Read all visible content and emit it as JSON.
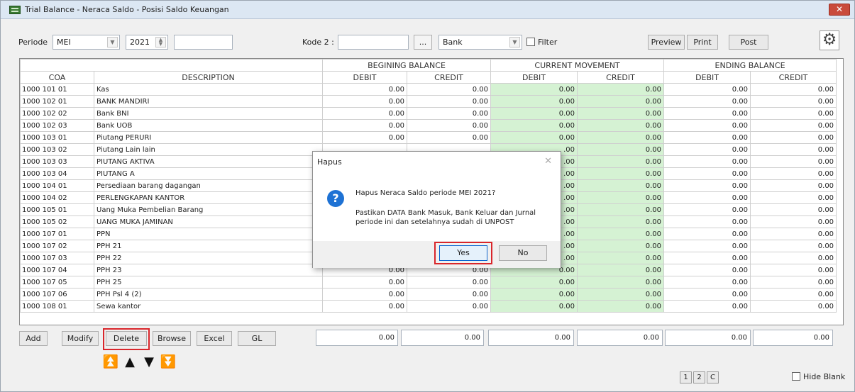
{
  "window": {
    "title": "Trial Balance - Neraca Saldo - Posisi Saldo Keuangan",
    "close_label": "✕"
  },
  "toolbar": {
    "periode_label": "Periode",
    "month": "MEI",
    "year": "2021",
    "extra_value": "",
    "kode2_label": "Kode 2 :",
    "kode2_value": "",
    "browse_label": "...",
    "bank_value": "Bank",
    "filter_label": "Filter",
    "preview_label": "Preview",
    "print_label": "Print",
    "post_label": "Post",
    "gear_icon": "gear-icon"
  },
  "grid": {
    "groups": [
      "BEGINING BALANCE",
      "CURRENT MOVEMENT",
      "ENDING BALANCE"
    ],
    "columns": [
      "COA",
      "DESCRIPTION",
      "DEBIT",
      "CREDIT",
      "DEBIT",
      "CREDIT",
      "DEBIT",
      "CREDIT"
    ],
    "rows": [
      {
        "coa": "1000 101 01",
        "desc": "Kas",
        "v": [
          "0.00",
          "0.00",
          "0.00",
          "0.00",
          "0.00",
          "0.00"
        ]
      },
      {
        "coa": "1000 102 01",
        "desc": "BANK MANDIRI",
        "v": [
          "0.00",
          "0.00",
          "0.00",
          "0.00",
          "0.00",
          "0.00"
        ]
      },
      {
        "coa": "1000 102 02",
        "desc": "Bank BNI",
        "v": [
          "0.00",
          "0.00",
          "0.00",
          "0.00",
          "0.00",
          "0.00"
        ]
      },
      {
        "coa": "1000 102 03",
        "desc": "Bank UOB",
        "v": [
          "0.00",
          "0.00",
          "0.00",
          "0.00",
          "0.00",
          "0.00"
        ]
      },
      {
        "coa": "1000 103 01",
        "desc": "Piutang PERURI",
        "v": [
          "0.00",
          "0.00",
          "0.00",
          "0.00",
          "0.00",
          "0.00"
        ]
      },
      {
        "coa": "1000 103 02",
        "desc": "Piutang Lain lain",
        "v": [
          "",
          "",
          ".00",
          "0.00",
          "0.00",
          "0.00"
        ]
      },
      {
        "coa": "1000 103 03",
        "desc": "PIUTANG AKTIVA",
        "v": [
          "",
          "",
          ".00",
          "0.00",
          "0.00",
          "0.00"
        ]
      },
      {
        "coa": "1000 103 04",
        "desc": "PIUTANG A",
        "v": [
          "",
          "",
          ".00",
          "0.00",
          "0.00",
          "0.00"
        ]
      },
      {
        "coa": "1000 104 01",
        "desc": "Persediaan barang dagangan",
        "v": [
          "",
          "",
          ".00",
          "0.00",
          "0.00",
          "0.00"
        ]
      },
      {
        "coa": "1000 104 02",
        "desc": "PERLENGKAPAN KANTOR",
        "v": [
          "",
          "",
          ".00",
          "0.00",
          "0.00",
          "0.00"
        ]
      },
      {
        "coa": "1000 105 01",
        "desc": "Uang  Muka Pembelian Barang",
        "v": [
          "",
          "",
          ".00",
          "0.00",
          "0.00",
          "0.00"
        ]
      },
      {
        "coa": "1000 105 02",
        "desc": "UANG MUKA JAMINAN",
        "v": [
          "",
          "",
          ".00",
          "0.00",
          "0.00",
          "0.00"
        ]
      },
      {
        "coa": "1000 107 01",
        "desc": "PPN",
        "v": [
          "",
          "",
          ".00",
          "0.00",
          "0.00",
          "0.00"
        ]
      },
      {
        "coa": "1000 107 02",
        "desc": "PPH 21",
        "v": [
          "",
          "",
          ".00",
          "0.00",
          "0.00",
          "0.00"
        ]
      },
      {
        "coa": "1000 107 03",
        "desc": "PPH 22",
        "v": [
          "",
          "",
          ".00",
          "0.00",
          "0.00",
          "0.00"
        ]
      },
      {
        "coa": "1000 107 04",
        "desc": "PPH 23",
        "v": [
          "0.00",
          "0.00",
          "0.00",
          "0.00",
          "0.00",
          "0.00"
        ]
      },
      {
        "coa": "1000 107 05",
        "desc": "PPH 25",
        "v": [
          "0.00",
          "0.00",
          "0.00",
          "0.00",
          "0.00",
          "0.00"
        ]
      },
      {
        "coa": "1000 107 06",
        "desc": "PPH Psl 4 (2)",
        "v": [
          "0.00",
          "0.00",
          "0.00",
          "0.00",
          "0.00",
          "0.00"
        ]
      },
      {
        "coa": "1000 108 01",
        "desc": "Sewa kantor",
        "v": [
          "0.00",
          "0.00",
          "0.00",
          "0.00",
          "0.00",
          "0.00"
        ]
      }
    ]
  },
  "footer": {
    "add_label": "Add",
    "modify_label": "Modify",
    "delete_label": "Delete",
    "browse_label": "Browse",
    "excel_label": "Excel",
    "gl_label": "GL",
    "totals": [
      "0.00",
      "0.00",
      "0.00",
      "0.00",
      "0.00",
      "0.00"
    ],
    "pages": [
      "1",
      "2",
      "C"
    ],
    "hide_blank_label": "Hide Blank"
  },
  "dialog": {
    "title": "Hapus",
    "close_label": "✕",
    "message": "Hapus Neraca Saldo periode MEI 2021?",
    "detail": "Pastikan DATA Bank Masuk, Bank Keluar dan Jurnal periode ini dan setelahnya sudah di UNPOST",
    "yes_label": "Yes",
    "no_label": "No",
    "icon": "question-icon"
  },
  "colors": {
    "accent_green": "#d5f2d3",
    "highlight_red": "#d9262b",
    "title_bar": "#dce7f3"
  }
}
